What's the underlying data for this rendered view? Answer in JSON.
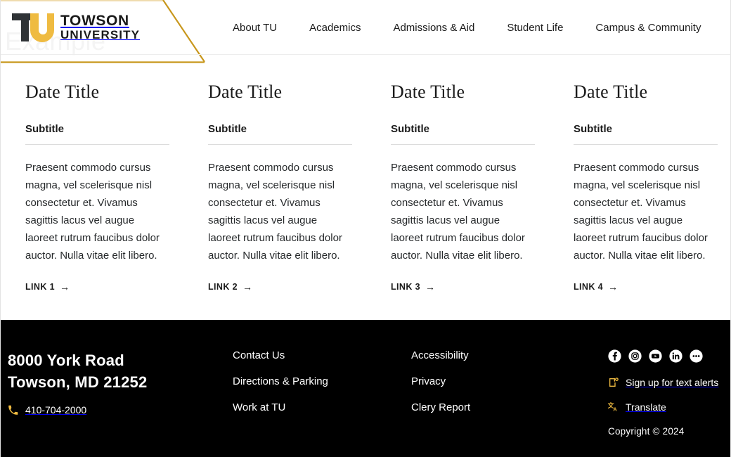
{
  "colors": {
    "gold": "#EFBB41",
    "gold_line": "#C8971C",
    "dark": "#1a1a1a",
    "footer_bg": "#000000",
    "divider": "#dcdcdc"
  },
  "header": {
    "watermark": "Example",
    "logo": {
      "mark_alt": "tu-monogram",
      "line1": "TOWSON",
      "line2": "UNIVERSITY"
    },
    "nav": [
      {
        "label": "About TU"
      },
      {
        "label": "Academics"
      },
      {
        "label": "Admissions & Aid"
      },
      {
        "label": "Student Life"
      },
      {
        "label": "Campus & Community"
      }
    ]
  },
  "cards": [
    {
      "title": "Date Title",
      "subtitle": "Subtitle",
      "body": "Praesent commodo cursus magna, vel scelerisque nisl consectetur et. Vivamus sagittis lacus vel augue laoreet rutrum faucibus dolor auctor. Nulla vitae elit libero.",
      "link": "LINK 1",
      "arrow": "→"
    },
    {
      "title": "Date Title",
      "subtitle": "Subtitle",
      "body": "Praesent commodo cursus magna, vel scelerisque nisl consectetur et. Vivamus sagittis lacus vel augue laoreet rutrum faucibus dolor auctor. Nulla vitae elit libero.",
      "link": "LINK 2",
      "arrow": "→"
    },
    {
      "title": "Date Title",
      "subtitle": "Subtitle",
      "body": "Praesent commodo cursus magna, vel scelerisque nisl consectetur et. Vivamus sagittis lacus vel augue laoreet rutrum faucibus dolor auctor. Nulla vitae elit libero.",
      "link": "LINK 3",
      "arrow": "→"
    },
    {
      "title": "Date Title",
      "subtitle": "Subtitle",
      "body": "Praesent commodo cursus magna, vel scelerisque nisl consectetur et. Vivamus sagittis lacus vel augue laoreet rutrum faucibus dolor auctor. Nulla vitae elit libero.",
      "link": "LINK 4",
      "arrow": "→"
    }
  ],
  "footer": {
    "address_line1": "8000 York Road",
    "address_line2": "Towson, MD 21252",
    "phone": "410-704-2000",
    "phone_icon": "phone-icon",
    "links_col1": [
      {
        "label": "Contact Us"
      },
      {
        "label": "Directions & Parking"
      },
      {
        "label": "Work at TU"
      }
    ],
    "links_col2": [
      {
        "label": "Accessibility"
      },
      {
        "label": "Privacy"
      },
      {
        "label": "Clery Report"
      }
    ],
    "social": [
      {
        "name": "facebook-icon"
      },
      {
        "name": "instagram-icon"
      },
      {
        "name": "youtube-icon"
      },
      {
        "name": "linkedin-icon"
      },
      {
        "name": "more-icon"
      }
    ],
    "text_alerts": "Sign up for text alerts",
    "text_alerts_icon": "mobile-alert-icon",
    "translate": "Translate",
    "translate_icon": "translate-icon",
    "copyright": "Copyright  © 2024"
  }
}
